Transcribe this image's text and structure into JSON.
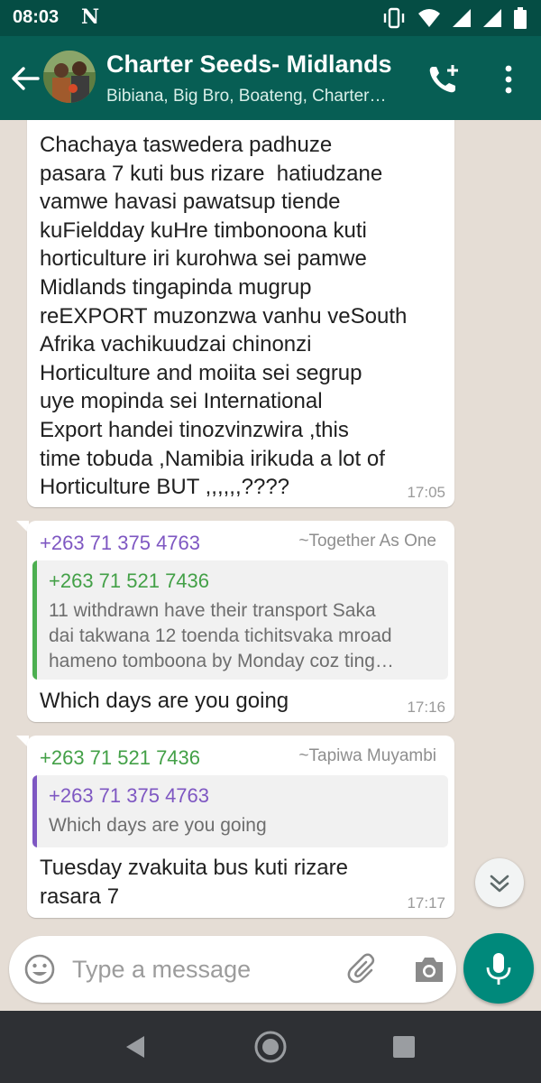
{
  "status_bar": {
    "time": "08:03",
    "notification_icon": "netflix-n-icon",
    "icons": [
      "vibrate-icon",
      "wifi-icon",
      "signal-icon",
      "signal-icon",
      "battery-icon"
    ]
  },
  "header": {
    "title": "Charter Seeds- Midlands",
    "subtitle": "Bibiana, Big Bro, Boateng, Charter…",
    "actions": [
      "add-call-icon",
      "more-vert-icon"
    ]
  },
  "messages": [
    {
      "text": "Chachaya taswedera padhuze\npasara 7 kuti bus rizare  hatiudzane\nvamwe havasi pawatsup tiende\nkuFieldday kuHre timbonoona kuti\nhorticulture iri kurohwa sei pamwe\nMidlands tingapinda mugrup\nreEXPORT muzonzwa vanhu veSouth\nAfrika vachikuudzai chinonzi\nHorticulture and moiita sei segrup\nuye mopinda sei International\nExport handei tinozvinzwira ,this\ntime tobuda ,Namibia irikuda a lot of\nHorticulture BUT ,,,,,,????",
      "time": "17:05"
    },
    {
      "sender": "+263 71 375 4763",
      "sender_color": "#7e57c2",
      "alias": "~Together As One",
      "quote": {
        "sender": "+263 71 521 7436",
        "sender_color": "#43a047",
        "bar_color": "#4caf50",
        "text": "11 withdrawn have their transport Saka\ndai takwana 12 toenda tichitsvaka mroad\nhameno tomboona by Monday coz ting…"
      },
      "text": "Which days are you going",
      "time": "17:16"
    },
    {
      "sender": "+263 71 521 7436",
      "sender_color": "#43a047",
      "alias": "~Tapiwa Muyambi",
      "quote": {
        "sender": "+263 71 375 4763",
        "sender_color": "#7e57c2",
        "bar_color": "#7e57c2",
        "text": "Which days are you going"
      },
      "text": "Tuesday zvakuita bus kuti rizare\nrasara 7",
      "time": "17:17"
    }
  ],
  "composer": {
    "placeholder": "Type a message",
    "icons": [
      "emoji-icon",
      "attach-icon",
      "camera-icon",
      "mic-icon"
    ]
  },
  "colors": {
    "header": "#075e54",
    "status_bar": "#054d44",
    "chat_bg": "#e5ddd5",
    "accent": "#00897b"
  }
}
